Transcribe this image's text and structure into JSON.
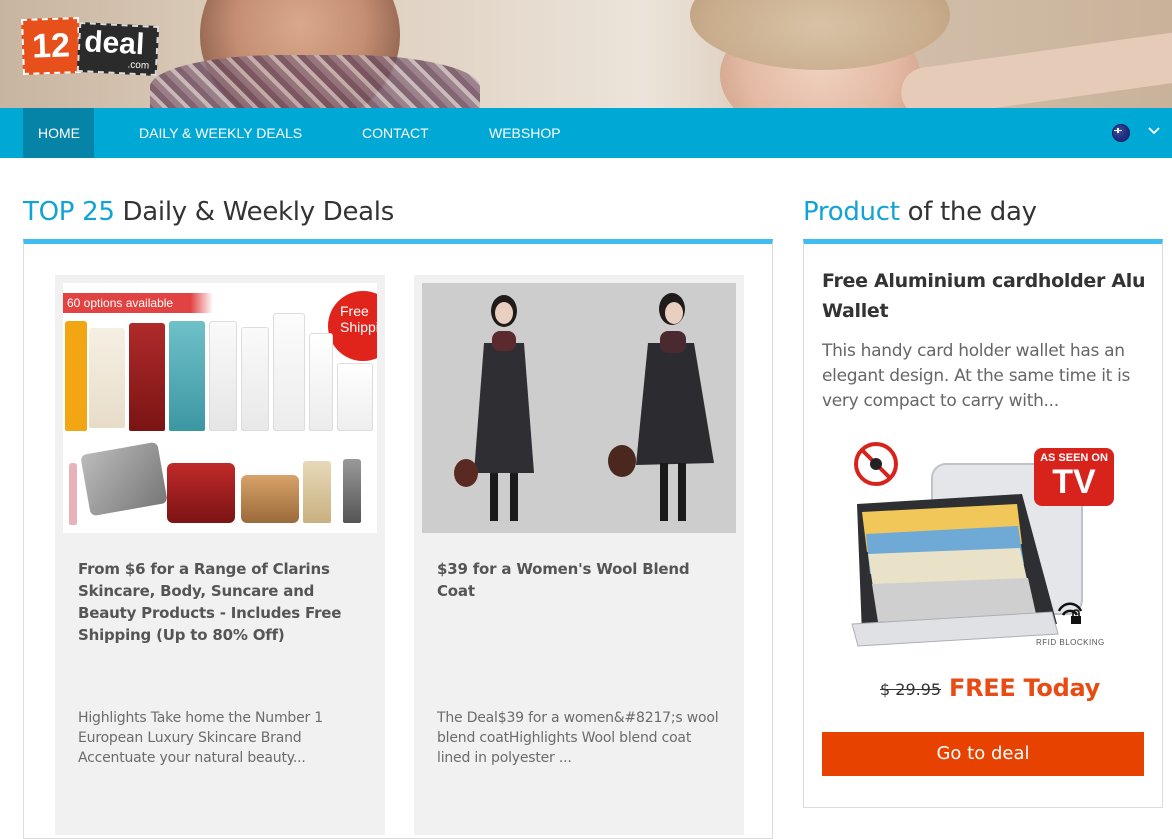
{
  "logo": {
    "number": "12",
    "word": "deal",
    "domain": ".com"
  },
  "nav": {
    "items": [
      {
        "label": "HOME",
        "active": true
      },
      {
        "label": "DAILY & WEEKLY DEALS",
        "active": false
      },
      {
        "label": "CONTACT",
        "active": false
      },
      {
        "label": "WEBSHOP",
        "active": false
      }
    ],
    "language_flag": "australia-flag-icon",
    "dropdown_icon": "chevron-down-icon"
  },
  "deals_section": {
    "title_highlight": "TOP 25",
    "title_rest": "Daily & Weekly Deals",
    "cards": [
      {
        "ribbon": "60 options available",
        "badge_line1": "Free",
        "badge_line2": "Shipping",
        "title": "From $6 for a Range of Clarins Skincare, Body, Suncare and Beauty Products - Includes Free Shipping (Up to 80% Off)",
        "description": "Highlights Take home the Number 1 European Luxury Skincare Brand Accentuate your natural beauty..."
      },
      {
        "title": "$39 for a Women's Wool Blend Coat",
        "description": "The Deal$39 for a women&#8217;s wool blend coatHighlights Wool blend coat lined in polyester ..."
      }
    ]
  },
  "product_section": {
    "title_highlight": "Product",
    "title_rest": "of the day",
    "product_title": "Free Aluminium cardholder Alu Wallet",
    "product_description": "This handy card holder wallet has an elegant design. At the same time it is very compact to carry with...",
    "tv_badge_small": "AS SEEN ON",
    "tv_badge_big": "TV",
    "rfid_label": "RFID BLOCKING",
    "old_price": "$ 29.95",
    "new_price": "FREE Today",
    "button_label": "Go to deal"
  },
  "colors": {
    "accent_blue": "#00a8d6",
    "nav_active": "#0584a7",
    "cta_orange": "#e84200"
  }
}
